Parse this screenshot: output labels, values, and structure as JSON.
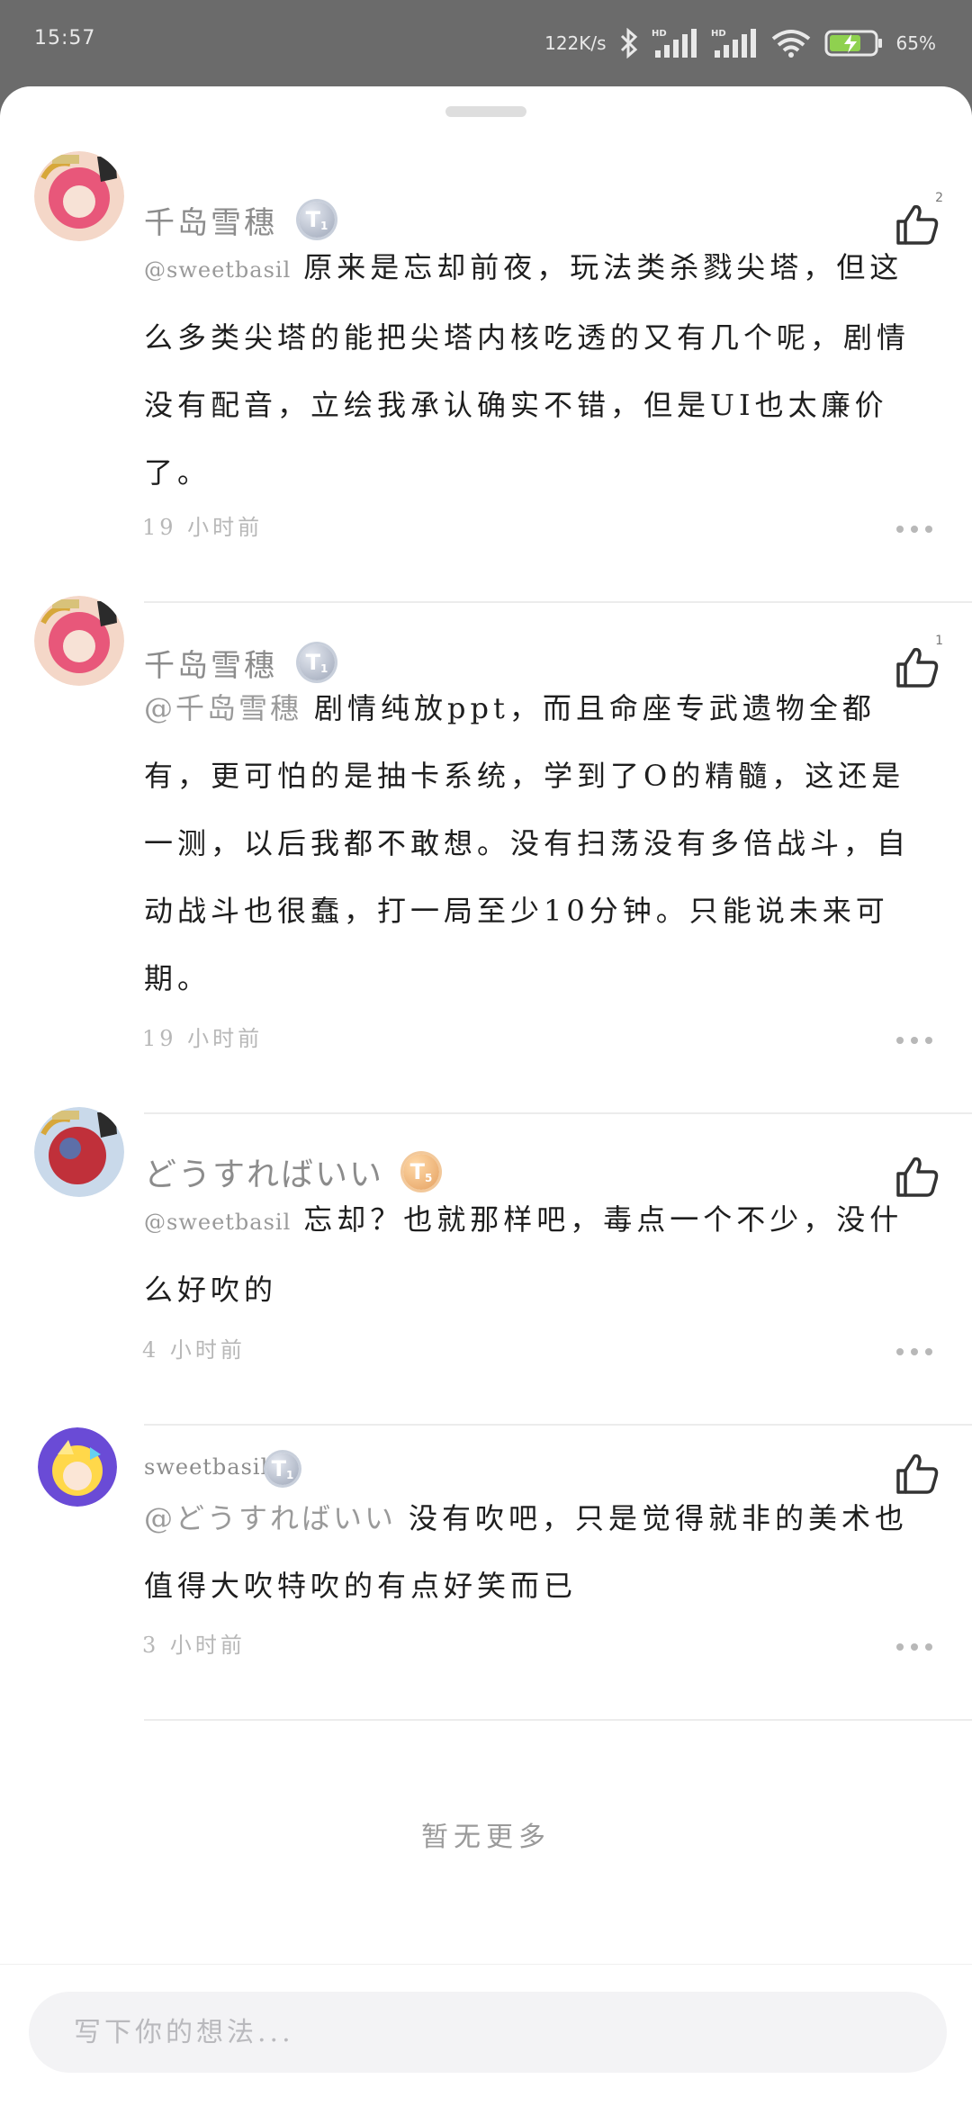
{
  "status_bar": {
    "time": "15:57",
    "net_speed": "122K/s",
    "battery": "65%"
  },
  "comments": [
    {
      "username": "千岛雪穗",
      "level": "1",
      "likes": "2",
      "mention": "@sweetbasil",
      "text": "原来是忘却前夜，玩法类杀戮尖塔，但这么多类尖塔的能把尖塔内核吃透的又有几个呢，剧情没有配音，立绘我承认确实不错，但是UI也太廉价了。",
      "time": "19 小时前"
    },
    {
      "username": "千岛雪穗",
      "level": "1",
      "likes": "1",
      "mention": "@千岛雪穗",
      "text": "剧情纯放ppt，而且命座专武遗物全都有，更可怕的是抽卡系统，学到了O的精髓，这还是一测，以后我都不敢想。没有扫荡没有多倍战斗，自动战斗也很蠢，打一局至少10分钟。只能说未来可期。",
      "time": "19 小时前"
    },
    {
      "username": "どうすればいい",
      "level": "5",
      "likes": "",
      "mention": "@sweetbasil",
      "text": "忘却？也就那样吧，毒点一个不少，没什么好吹的",
      "time": "4 小时前"
    },
    {
      "username": "sweetbasil",
      "level": "1",
      "likes": "",
      "mention": "@どうすればいい",
      "text": "没有吹吧，只是觉得就非的美术也值得大吹特吹的有点好笑而已",
      "time": "3 小时前"
    }
  ],
  "footer_text": "暂无更多",
  "input": {
    "placeholder": "写下你的想法..."
  },
  "colors": {
    "status_bar_bg": "#6b6b6b",
    "badge_silver": "#b7bfcd",
    "badge_gold": "#eab27a"
  }
}
